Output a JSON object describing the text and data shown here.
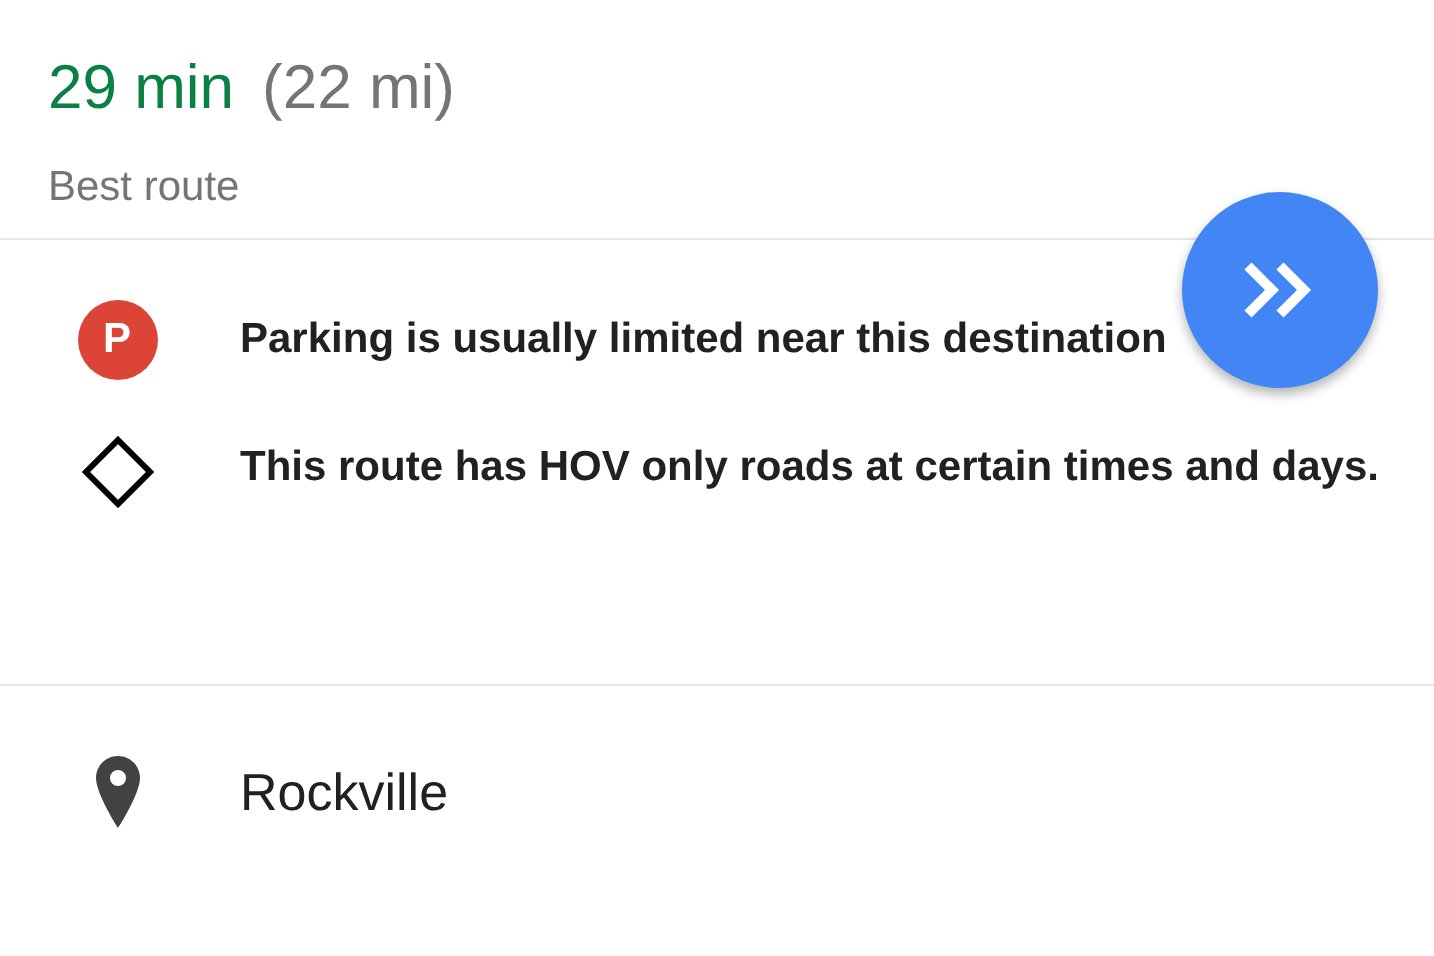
{
  "route": {
    "duration": "29 min",
    "distance": "(22 mi)",
    "label": "Best route"
  },
  "notices": [
    {
      "kind": "parking",
      "icon_text": "P",
      "text": "Parking is usually limited near this destination"
    },
    {
      "kind": "hov",
      "text": "This route has HOV only roads at certain times and days."
    }
  ],
  "destination": {
    "name": "Rockville"
  }
}
